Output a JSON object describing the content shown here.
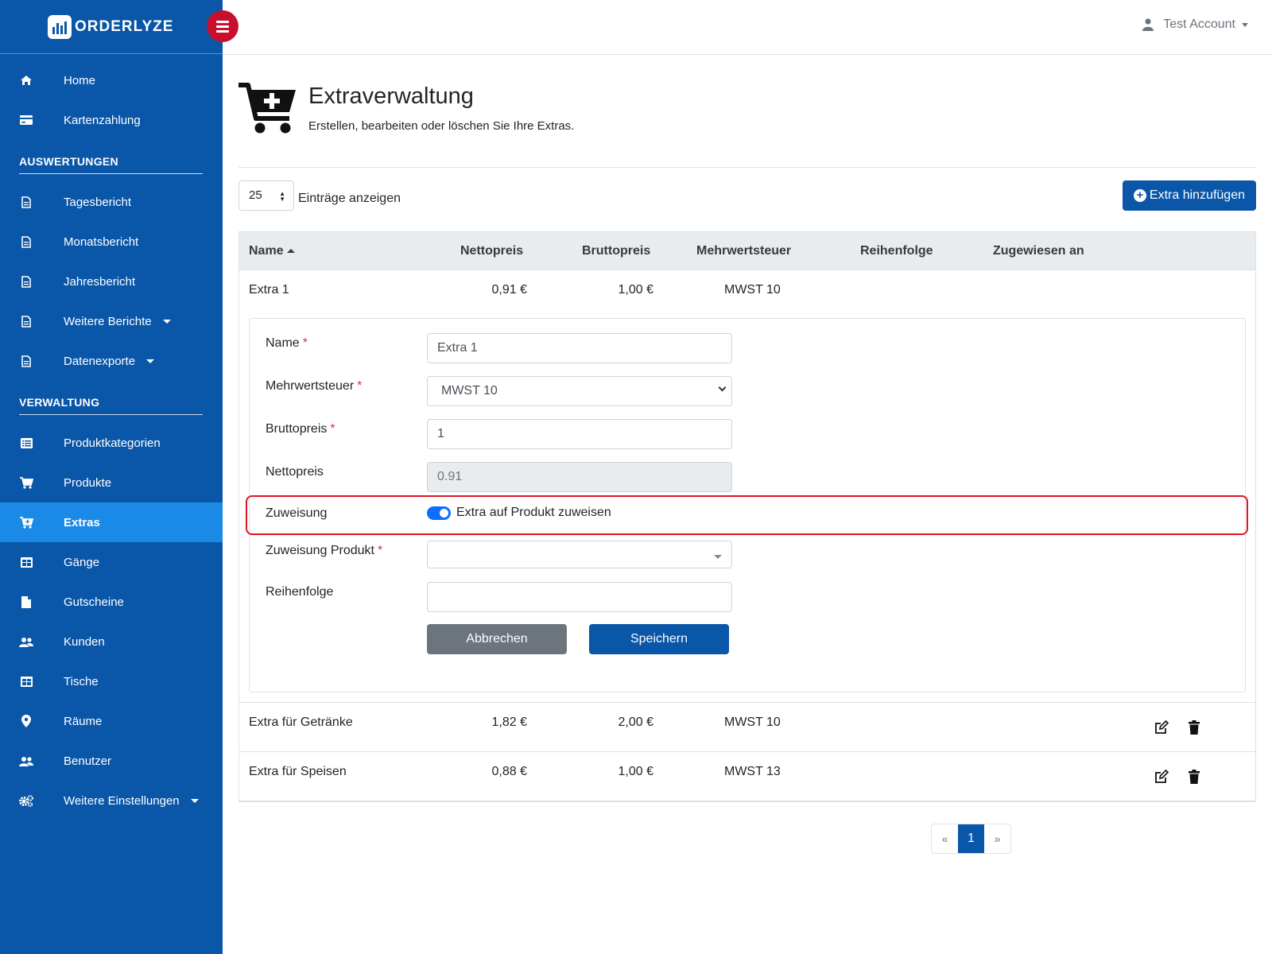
{
  "brand": {
    "name": "ORDERLYZE"
  },
  "account": {
    "name": "Test Account"
  },
  "sidebar": {
    "top_items": [
      {
        "label": "Home",
        "icon": "home-icon"
      },
      {
        "label": "Kartenzahlung",
        "icon": "credit-card-icon"
      }
    ],
    "section_reports": "AUSWERTUNGEN",
    "report_items": [
      {
        "label": "Tagesbericht",
        "icon": "file-icon"
      },
      {
        "label": "Monatsbericht",
        "icon": "file-icon"
      },
      {
        "label": "Jahresbericht",
        "icon": "file-icon"
      },
      {
        "label": "Weitere Berichte",
        "icon": "file-icon"
      },
      {
        "label": "Datenexporte",
        "icon": "file-icon"
      }
    ],
    "section_admin": "VERWALTUNG",
    "admin_items": [
      {
        "label": "Produktkategorien",
        "icon": "list-icon"
      },
      {
        "label": "Produkte",
        "icon": "cart-icon"
      },
      {
        "label": "Extras",
        "icon": "cart-plus-icon",
        "active": true
      },
      {
        "label": "Gänge",
        "icon": "table-icon"
      },
      {
        "label": "Gutscheine",
        "icon": "document-icon"
      },
      {
        "label": "Kunden",
        "icon": "users-icon"
      },
      {
        "label": "Tische",
        "icon": "table-icon"
      },
      {
        "label": "Räume",
        "icon": "map-marker-icon"
      },
      {
        "label": "Benutzer",
        "icon": "users-icon"
      },
      {
        "label": "Weitere Einstellungen",
        "icon": "cogs-icon"
      }
    ]
  },
  "page": {
    "title": "Extraverwaltung",
    "subtitle": "Erstellen, bearbeiten oder löschen Sie Ihre Extras."
  },
  "toolbar": {
    "page_length": "25",
    "page_length_label": "Einträge anzeigen",
    "add_label": "Extra hinzufügen"
  },
  "table": {
    "headers": {
      "name": "Name",
      "net": "Nettopreis",
      "gross": "Bruttopreis",
      "tax": "Mehrwertsteuer",
      "order": "Reihenfolge",
      "assigned": "Zugewiesen an"
    },
    "rows": [
      {
        "name": "Extra 1",
        "net": "0,91 €",
        "gross": "1,00 €",
        "tax": "MWST 10"
      },
      {
        "name": "Extra für Getränke",
        "net": "1,82 €",
        "gross": "2,00 €",
        "tax": "MWST 10"
      },
      {
        "name": "Extra für Speisen",
        "net": "0,88 €",
        "gross": "1,00 €",
        "tax": "MWST 13"
      }
    ]
  },
  "form": {
    "name_label": "Name",
    "name_value": "Extra 1",
    "tax_label": "Mehrwertsteuer",
    "tax_value": "MWST 10",
    "gross_label": "Bruttopreis",
    "gross_value": "1",
    "net_label": "Nettopreis",
    "net_value": "0.91",
    "assign_label": "Zuweisung",
    "assign_toggle_label": "Extra auf Produkt zuweisen",
    "assign_toggle_on": true,
    "assign_product_label": "Zuweisung Produkt",
    "assign_product_value": "",
    "order_label": "Reihenfolge",
    "order_value": "",
    "cancel_label": "Abbrechen",
    "save_label": "Speichern",
    "required_mark": "*"
  },
  "pagination": {
    "prev": "«",
    "current": "1",
    "next": "»"
  },
  "colors": {
    "sidebar": "#0a56a8",
    "active": "#1a8ae6",
    "toggle_button": "#c8102e",
    "highlight": "#e0151f"
  }
}
